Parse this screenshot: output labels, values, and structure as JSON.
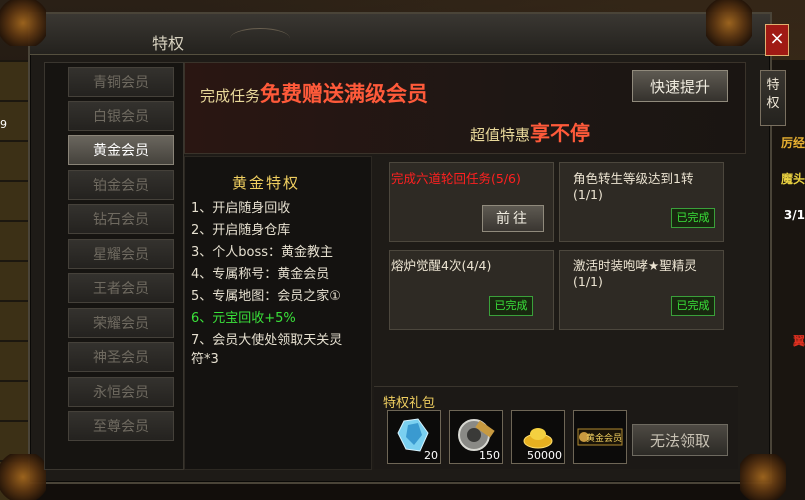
{
  "window": {
    "title": "特权",
    "close_symbol": "×",
    "side_tab": "特权"
  },
  "background_text": {
    "left_number": "9",
    "right_labels": [
      "厉经",
      "魔头",
      "3/1",
      "翼"
    ],
    "right_label_colors": [
      "#e8b030",
      "#e8d040",
      "#ffffff",
      "#e03020"
    ]
  },
  "nav": {
    "items": [
      "青铜会员",
      "白银会员",
      "黄金会员",
      "铂金会员",
      "钻石会员",
      "星耀会员",
      "王者会员",
      "荣耀会员",
      "神圣会员",
      "永恒会员",
      "至尊会员"
    ],
    "active_index": 2
  },
  "banner": {
    "line1_prefix": "完成任务",
    "line1_highlight": "免费赠送满级会员",
    "line2_prefix": "超值特惠",
    "line2_highlight": "享不停",
    "upgrade_button": "快速提升"
  },
  "privileges": {
    "title": "黄金特权",
    "items": [
      {
        "text": "1、开启随身回收",
        "highlight": false
      },
      {
        "text": "2、开启随身仓库",
        "highlight": false
      },
      {
        "text": "3、个人boss：黄金教主",
        "highlight": false
      },
      {
        "text": "4、专属称号：黄金会员",
        "highlight": false
      },
      {
        "text": "5、专属地图：会员之家①",
        "highlight": false
      },
      {
        "text": "6、元宝回收+5%",
        "highlight": true
      },
      {
        "text": "7、会员大使处领取天关灵",
        "highlight": false
      },
      {
        "text": "符*3",
        "highlight": false
      }
    ]
  },
  "tasks": [
    {
      "text": "完成六道轮回任务(5/6)",
      "status": "in_progress",
      "button": "前往"
    },
    {
      "text": "角色转生等级达到1转(1/1)",
      "status": "done",
      "badge": "已完成"
    },
    {
      "text": "熔炉觉醒4次(4/4)",
      "status": "done",
      "badge": "已完成"
    },
    {
      "text": "激活时装咆哮★聖精灵(1/1)",
      "status": "done",
      "badge": "已完成"
    }
  ],
  "gift": {
    "title": "特权礼包",
    "items": [
      {
        "icon": "crystal-icon",
        "count": "20"
      },
      {
        "icon": "gear-hammer-icon",
        "count": "150"
      },
      {
        "icon": "gold-ingot-icon",
        "count": "50000"
      },
      {
        "icon": "gold-member-title-icon",
        "count": "",
        "label": "黄金会员"
      }
    ],
    "claim_button": "无法领取"
  },
  "colors": {
    "accent_gold": "#f0cf60",
    "highlight_red": "#ff5a3a",
    "done_green": "#3ae23a",
    "task_red": "#ff2020"
  }
}
